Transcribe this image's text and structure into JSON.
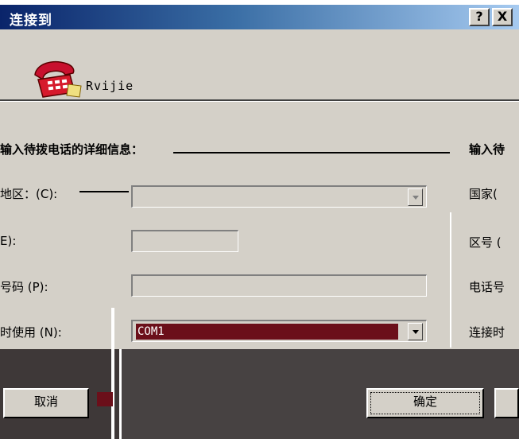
{
  "window": {
    "title": "连接到",
    "help_label": "?",
    "close_label": "X"
  },
  "connection": {
    "name": "Rvijie",
    "icon": "telephone-icon"
  },
  "form": {
    "instruction": "输入待拨电话的详细信息：",
    "right_title": "输入待",
    "left_labels": {
      "country": "地区：(C):",
      "area": "E):",
      "phone": "号码 (P):",
      "connect_using": "时使用 (N):"
    },
    "right_labels": {
      "country": "国家(",
      "area": "区号 (",
      "phone": "电话号",
      "connect_using": "连接时"
    },
    "country_value": "",
    "area_value": "",
    "phone_value": "",
    "port_value": "COM1"
  },
  "buttons": {
    "cancel": "取消",
    "ok": "确定"
  },
  "colors": {
    "title_start": "#0a246a",
    "title_end": "#a6caf0",
    "selection": "#6b0f1a",
    "dialog_face": "#d4d0c8"
  }
}
